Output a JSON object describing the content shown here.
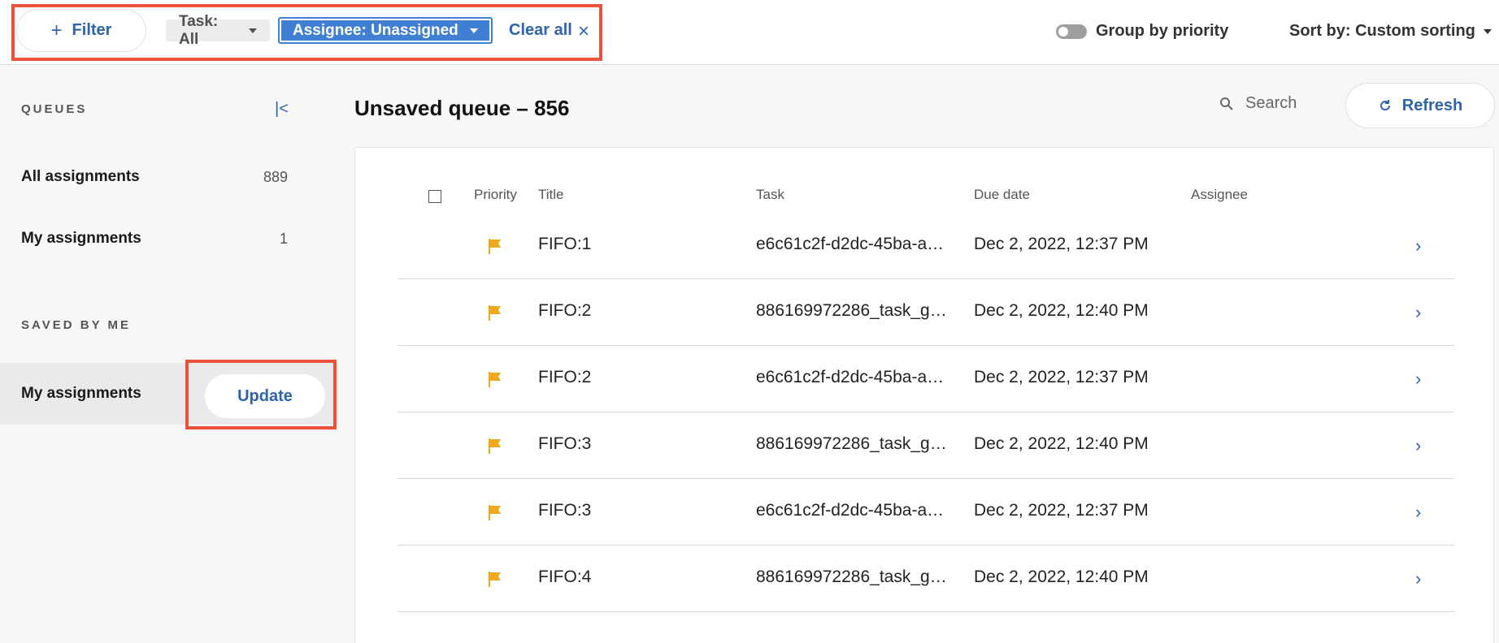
{
  "colors": {
    "accent": "#2f63ad",
    "highlight": "#e8533a",
    "chip_active": "#3f7fd4",
    "priority_flag": "#f0a81c"
  },
  "toolbar": {
    "filter_label": "Filter",
    "chip_task": "Task: All",
    "chip_assignee": "Assignee: Unassigned",
    "clear_all": "Clear all",
    "clear_icon": "×",
    "group_by_priority": "Group by priority",
    "group_by_priority_on": false,
    "sort_label": "Sort by: Custom sorting"
  },
  "sidebar": {
    "queues_title": "QUEUES",
    "collapse_icon": "|<",
    "queues": [
      {
        "label": "All assignments",
        "count": "889"
      },
      {
        "label": "My assignments",
        "count": "1"
      }
    ],
    "saved_title": "SAVED BY ME",
    "saved": [
      {
        "label": "My assignments",
        "action": "Update"
      }
    ]
  },
  "main": {
    "title": "Unsaved queue – 856",
    "search_placeholder": "Search",
    "refresh_label": "Refresh",
    "columns": {
      "priority": "Priority",
      "title": "Title",
      "task": "Task",
      "due": "Due date",
      "assignee": "Assignee"
    },
    "rows": [
      {
        "title": "FIFO:1",
        "task": "e6c61c2f-d2dc-45ba-a…",
        "due": "Dec 2, 2022, 12:37 PM",
        "assignee": ""
      },
      {
        "title": "FIFO:2",
        "task": "886169972286_task_g…",
        "due": "Dec 2, 2022, 12:40 PM",
        "assignee": ""
      },
      {
        "title": "FIFO:2",
        "task": "e6c61c2f-d2dc-45ba-a…",
        "due": "Dec 2, 2022, 12:37 PM",
        "assignee": ""
      },
      {
        "title": "FIFO:3",
        "task": "886169972286_task_g…",
        "due": "Dec 2, 2022, 12:40 PM",
        "assignee": ""
      },
      {
        "title": "FIFO:3",
        "task": "e6c61c2f-d2dc-45ba-a…",
        "due": "Dec 2, 2022, 12:37 PM",
        "assignee": ""
      },
      {
        "title": "FIFO:4",
        "task": "886169972286_task_g…",
        "due": "Dec 2, 2022, 12:40 PM",
        "assignee": ""
      }
    ]
  }
}
